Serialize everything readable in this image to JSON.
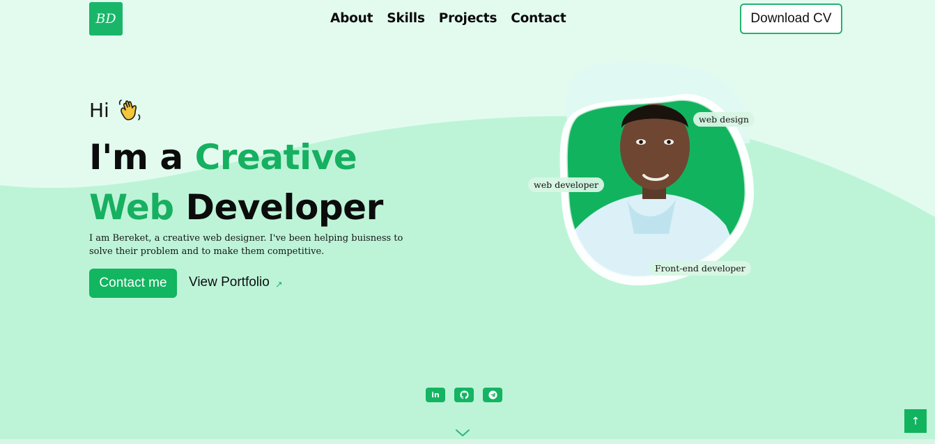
{
  "brand": {
    "logo_text": "BD"
  },
  "nav": {
    "items": [
      {
        "label": "About"
      },
      {
        "label": "Skills"
      },
      {
        "label": "Projects"
      },
      {
        "label": "Contact"
      }
    ],
    "cv_button": "Download CV"
  },
  "hero": {
    "greeting": "Hi",
    "headline": {
      "part1": "I'm a ",
      "highlight1": "Creative",
      "highlight2": "Web",
      "part2": " Developer"
    },
    "description": "I am Bereket, a creative web designer. I've been helping buisness to solve their problem and to make them competitive.",
    "contact_button": "Contact me",
    "portfolio_link": "View Portfolio"
  },
  "portrait": {
    "tags": {
      "design": "web design",
      "developer": "web developer",
      "frontend": "Front-end developer"
    }
  },
  "socials": [
    {
      "icon": "linkedin-icon",
      "label": "in"
    },
    {
      "icon": "github-icon"
    },
    {
      "icon": "telegram-icon"
    }
  ],
  "back_to_top": "↑",
  "icons": {
    "wave": "waving-hand-icon",
    "arrow": "arrow-up-right-icon",
    "scroll": "chevron-down-icon"
  },
  "colors": {
    "accent": "#12b560",
    "background_top": "#e3fbef",
    "background_wave": "#bdf4d8"
  }
}
